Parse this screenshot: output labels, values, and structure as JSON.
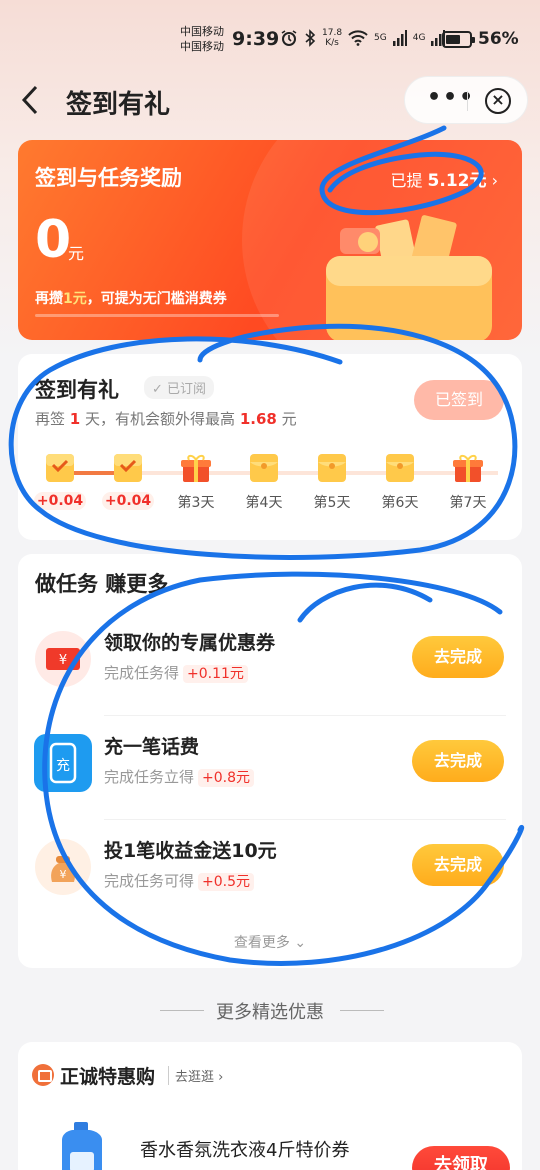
{
  "status_bar": {
    "carrier_1": "中国移动",
    "carrier_2": "中国移动",
    "time": "9:39",
    "net_speed_value": "17.8",
    "net_speed_unit": "K/s",
    "signal_1_tag": "5G",
    "signal_2_tag": "4G",
    "battery_percent": "56%"
  },
  "nav": {
    "title": "签到有礼"
  },
  "reward_card": {
    "title": "签到与任务奖励",
    "withdrawn_prefix": "已提",
    "withdrawn_amount": "5.12元",
    "withdrawn_arrow": "›",
    "balance": "0",
    "balance_unit": "元",
    "hint_prefix": "再攒",
    "hint_value": "1元",
    "hint_suffix": "，可提为无门槛消费券",
    "progress_fraction": 0.0
  },
  "signin": {
    "title": "签到有礼",
    "subscribed_tag": "✓ 已订阅",
    "desc_a": "再签",
    "desc_days": "1",
    "desc_b": "天，有机会额外得最高",
    "desc_amount": "1.68",
    "desc_unit": "元",
    "button": "已签到",
    "days": [
      {
        "label": "+0.04",
        "done": true,
        "icon": "checked-envelope"
      },
      {
        "label": "+0.04",
        "done": true,
        "icon": "checked-envelope"
      },
      {
        "label": "第3天",
        "done": false,
        "icon": "gift-box"
      },
      {
        "label": "第4天",
        "done": false,
        "icon": "red-envelope"
      },
      {
        "label": "第5天",
        "done": false,
        "icon": "red-envelope"
      },
      {
        "label": "第6天",
        "done": false,
        "icon": "red-envelope"
      },
      {
        "label": "第7天",
        "done": false,
        "icon": "gift-box"
      }
    ]
  },
  "tasks": {
    "title": "做任务 赚更多",
    "items": [
      {
        "name": "领取你的专属优惠券",
        "sub": "完成任务得",
        "reward": "+0.11元",
        "button": "去完成",
        "icon": "coupon-icon"
      },
      {
        "name": "充一笔话费",
        "sub": "完成任务立得",
        "reward": "+0.8元",
        "button": "去完成",
        "icon": "phone-recharge-icon"
      },
      {
        "name": "投1笔收益金送10元",
        "sub": "完成任务可得",
        "reward": "+0.5元",
        "button": "去完成",
        "icon": "coin-bag-icon"
      }
    ],
    "see_more": "查看更多 ⌄"
  },
  "more_deals": {
    "title": "更多精选优惠"
  },
  "shop": {
    "name": "正诚特惠购",
    "link": "去逛逛 ›",
    "product_name": "香水香氛洗衣液4斤特价券",
    "claim_button": "去领取"
  },
  "colors": {
    "accent": "#ff4a22",
    "red_text": "#f0302a",
    "button_orange": "#ffac1c",
    "annotation_blue": "#1a73e8"
  }
}
